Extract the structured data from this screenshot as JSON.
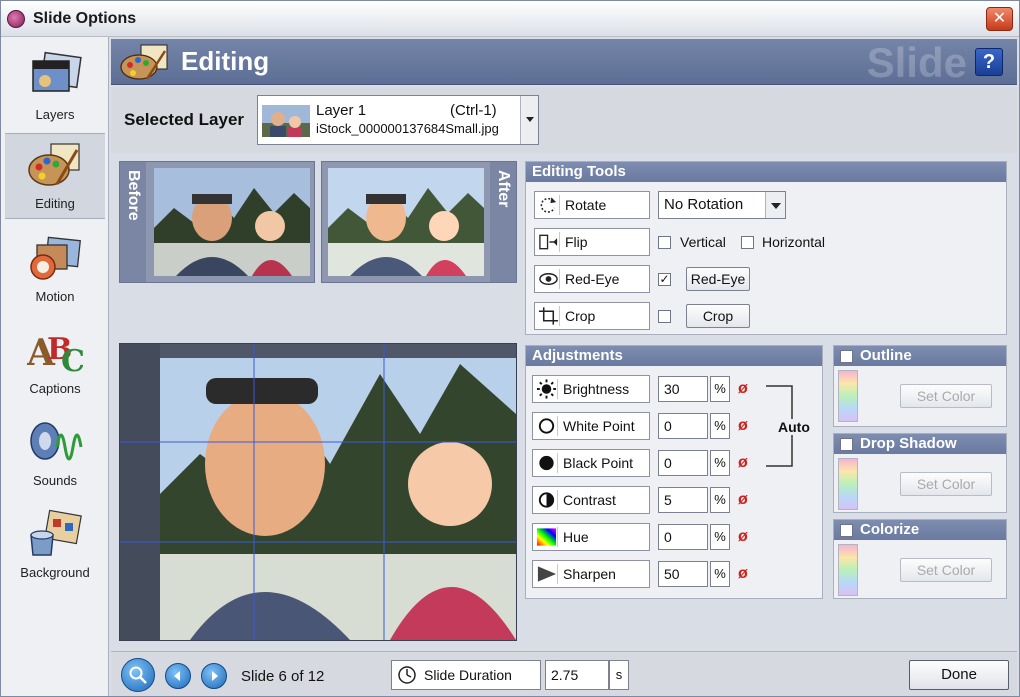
{
  "window": {
    "title": "Slide Options",
    "close_icon": "close-icon"
  },
  "sidebar": {
    "items": [
      {
        "label": "Layers",
        "icon": "layers-icon"
      },
      {
        "label": "Editing",
        "icon": "palette-icon",
        "active": true
      },
      {
        "label": "Motion",
        "icon": "motion-icon"
      },
      {
        "label": "Captions",
        "icon": "captions-icon"
      },
      {
        "label": "Sounds",
        "icon": "sounds-icon"
      },
      {
        "label": "Background",
        "icon": "background-icon"
      }
    ]
  },
  "header": {
    "title": "Editing",
    "watermark": "Slide",
    "help_label": "?"
  },
  "selected_layer": {
    "label": "Selected Layer",
    "name": "Layer  1",
    "shortcut": "(Ctrl-1)",
    "file": "iStock_000000137684Small.jpg"
  },
  "preview": {
    "before_label": "Before",
    "after_label": "After"
  },
  "editing_tools": {
    "title": "Editing Tools",
    "rotate": {
      "label": "Rotate",
      "value": "No Rotation"
    },
    "flip": {
      "label": "Flip",
      "vertical": "Vertical",
      "horizontal": "Horizontal",
      "vertical_checked": false,
      "horizontal_checked": false
    },
    "redeye": {
      "label": "Red-Eye",
      "button": "Red-Eye",
      "checked": true
    },
    "crop": {
      "label": "Crop",
      "button": "Crop",
      "checked": false
    }
  },
  "adjustments": {
    "title": "Adjustments",
    "auto_label": "Auto",
    "items": [
      {
        "label": "Brightness",
        "value": "30",
        "unit": "%"
      },
      {
        "label": "White Point",
        "value": "0",
        "unit": "%"
      },
      {
        "label": "Black Point",
        "value": "0",
        "unit": "%"
      },
      {
        "label": "Contrast",
        "value": "5",
        "unit": "%"
      },
      {
        "label": "Hue",
        "value": "0",
        "unit": "%"
      },
      {
        "label": "Sharpen",
        "value": "50",
        "unit": "%"
      }
    ]
  },
  "effects": {
    "outline": {
      "title": "Outline",
      "button": "Set Color"
    },
    "drop_shadow": {
      "title": "Drop Shadow",
      "button": "Set Color"
    },
    "colorize": {
      "title": "Colorize",
      "button": "Set Color"
    }
  },
  "bottom": {
    "slide_count": "Slide 6 of 12",
    "duration_label": "Slide Duration",
    "duration_value": "2.75",
    "duration_unit": "s",
    "done": "Done"
  },
  "colors": {
    "header": "#6878a0",
    "group_head": "#7585a8",
    "reset": "#d0211c"
  }
}
